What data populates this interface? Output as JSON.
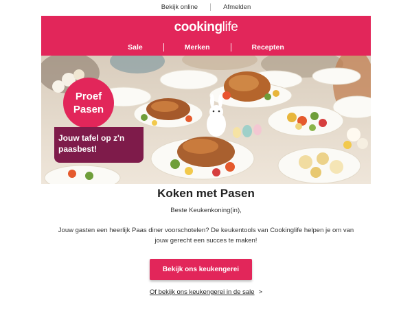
{
  "topbar": {
    "view_online": "Bekijk online",
    "unsubscribe": "Afmelden"
  },
  "header": {
    "logo_bold": "cooking",
    "logo_light": "life",
    "nav": [
      "Sale",
      "Merken",
      "Recepten"
    ]
  },
  "hero": {
    "badge_line1": "Proef",
    "badge_line2": "Pasen",
    "tagline_line1": "Jouw tafel op z'n",
    "tagline_line2": "paasbest!"
  },
  "content": {
    "title": "Koken met Pasen",
    "greeting": "Beste Keukenkoning(in),",
    "body_line1": "Jouw gasten een heerlijk Paas diner voorschotelen? De keukentools van Cookinglife helpen je om van",
    "body_line2": "jouw gerecht een succes te maken!",
    "cta": "Bekijk ons keukengerei",
    "sale_link": "Of bekijk ons keukengerei in de sale",
    "sale_chevron": ">"
  },
  "colors": {
    "brand": "#e2265a",
    "badge_dark": "#7e1b4a"
  }
}
